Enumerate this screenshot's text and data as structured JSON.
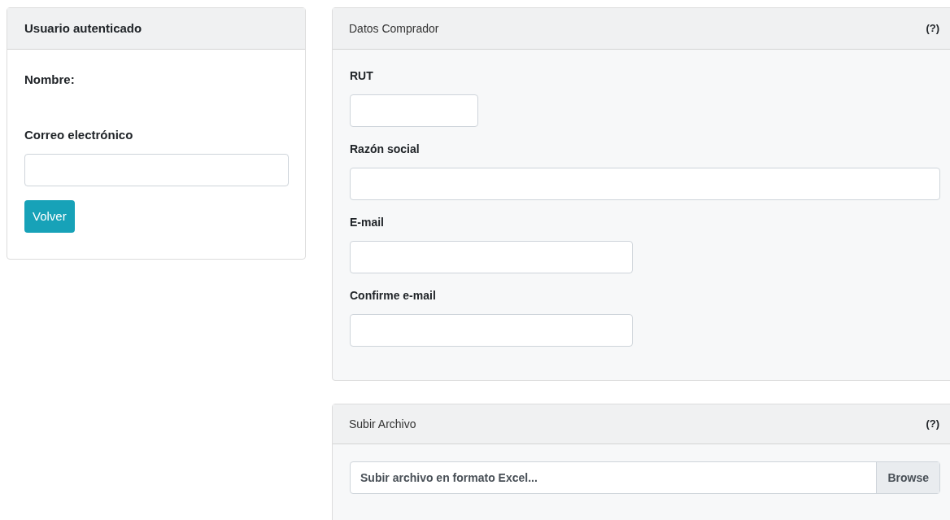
{
  "user_card": {
    "title": "Usuario autenticado",
    "name_label": "Nombre:",
    "email_label": "Correo electrónico",
    "back_button": "Volver"
  },
  "buyer_card": {
    "title": "Datos Comprador",
    "help": "(?)",
    "fields": [
      {
        "label": "RUT"
      },
      {
        "label": "Razón social"
      },
      {
        "label": "E-mail"
      },
      {
        "label": "Confirme e-mail"
      }
    ]
  },
  "upload_card": {
    "title": "Subir Archivo",
    "help": "(?)",
    "file_placeholder": "Subir archivo en formato Excel...",
    "browse_button": "Browse"
  }
}
